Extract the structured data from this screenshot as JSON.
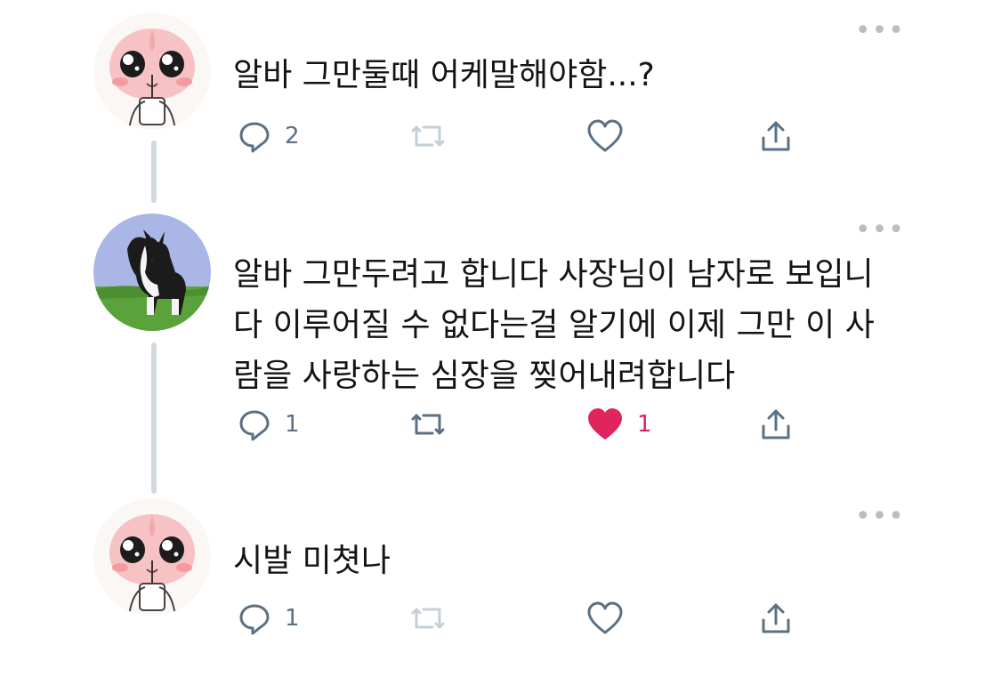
{
  "thread": [
    {
      "avatar": "peach-character-avatar",
      "text": "알바 그만둘때 어케말해야함...?",
      "actions": {
        "reply_count": "2",
        "retweet_count": "",
        "like_count": "",
        "liked": false
      }
    },
    {
      "avatar": "border-collie-avatar",
      "text": "알바 그만두려고 합니다 사장님이 남자로 보입니\n다 이루어질 수 없다는걸 알기에 이제 그만 이 사\n람을 사랑하는 심장을 찢어내려합니다",
      "actions": {
        "reply_count": "1",
        "retweet_count": "",
        "like_count": "1",
        "liked": true
      }
    },
    {
      "avatar": "peach-character-avatar",
      "text": "시발 미쳣나",
      "actions": {
        "reply_count": "1",
        "retweet_count": "",
        "like_count": "",
        "liked": false
      }
    }
  ],
  "more_label": "•••",
  "colors": {
    "icon_gray": "#5b7083",
    "retweet_disabled": "#c4cfd6",
    "like_red": "#e0245e",
    "thread_line": "#cfd9de"
  }
}
